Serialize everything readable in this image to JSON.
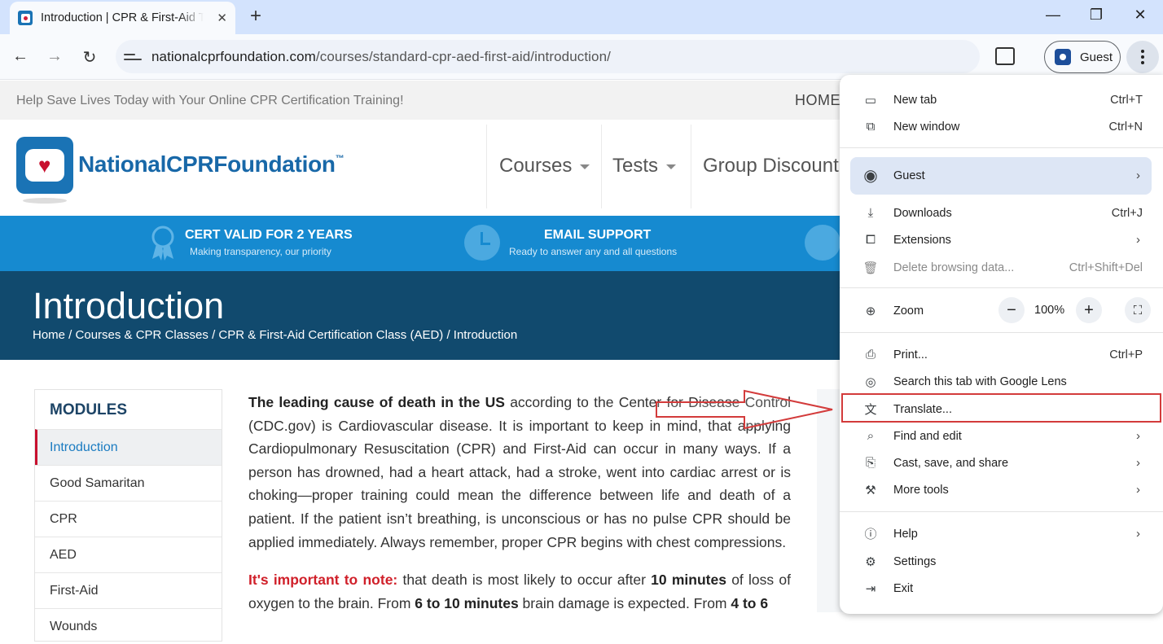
{
  "browser": {
    "tab_title": "Introduction | CPR & First-Aid Training",
    "new_tab_symbol": "+",
    "url_host": "nationalcprfoundation.com",
    "url_path": "/courses/standard-cpr-aed-first-aid/introduction/",
    "profile_label": "Guest",
    "window_controls": [
      "—",
      "❐",
      "✕"
    ],
    "nav": {
      "back": "←",
      "forward": "→",
      "reload": "↻"
    }
  },
  "site": {
    "tagline": "Help Save Lives Today with Your Online CPR Certification Training!",
    "home_link": "HOME",
    "logo_text": "NationalCPRFoundation",
    "logo_tm": "™",
    "nav": [
      "Courses",
      "Tests",
      "Group Discount"
    ],
    "features": [
      {
        "title": "CERT VALID FOR 2 YEARS",
        "subtitle": "Making transparency, our priority"
      },
      {
        "title": "EMAIL SUPPORT",
        "subtitle": "Ready to answer any and all questions"
      }
    ],
    "page_title": "Introduction",
    "breadcrumb": "Home / Courses & CPR Classes / CPR & First-Aid Certification Class (AED) / Introduction",
    "modules_title": "MODULES",
    "modules": [
      "Introduction",
      "Good Samaritan",
      "CPR",
      "AED",
      "First-Aid",
      "Wounds"
    ],
    "article": {
      "p1_bold": "The leading cause of death in the US",
      "p1_text": " according to the Center for Disease Control (CDC.gov) is Cardiovascular disease. It is important to keep in mind, that applying Cardiopulmonary Resuscitation (CPR) and First-Aid can occur in many ways. If a person has drowned, had a heart attack, had a stroke, went into cardiac arrest or is choking—proper training could mean the difference between life and death of a patient. If the patient isn’t breathing, is unconscious or has no pulse CPR should be applied immediately. Always remember, proper CPR begins with chest compressions.",
      "p2_red": "It's important to note:",
      "p2_a": " that death is most likely to occur after ",
      "p2_b1": "10 minutes",
      "p2_c": " of loss of oxygen to the brain. From ",
      "p2_b2": "6 to 10 minutes",
      "p2_d": " brain damage is expected. From ",
      "p2_b3": "4 to 6"
    }
  },
  "menu": {
    "new_tab": "New tab",
    "new_tab_sc": "Ctrl+T",
    "new_window": "New window",
    "new_window_sc": "Ctrl+N",
    "guest": "Guest",
    "downloads": "Downloads",
    "downloads_sc": "Ctrl+J",
    "extensions": "Extensions",
    "delete_data": "Delete browsing data...",
    "delete_data_sc": "Ctrl+Shift+Del",
    "zoom": "Zoom",
    "zoom_value": "100%",
    "zoom_minus": "−",
    "zoom_plus": "+",
    "print": "Print...",
    "print_sc": "Ctrl+P",
    "lens": "Search this tab with Google Lens",
    "translate": "Translate...",
    "find_edit": "Find and edit",
    "cast": "Cast, save, and share",
    "more_tools": "More tools",
    "help": "Help",
    "settings": "Settings",
    "exit": "Exit"
  }
}
